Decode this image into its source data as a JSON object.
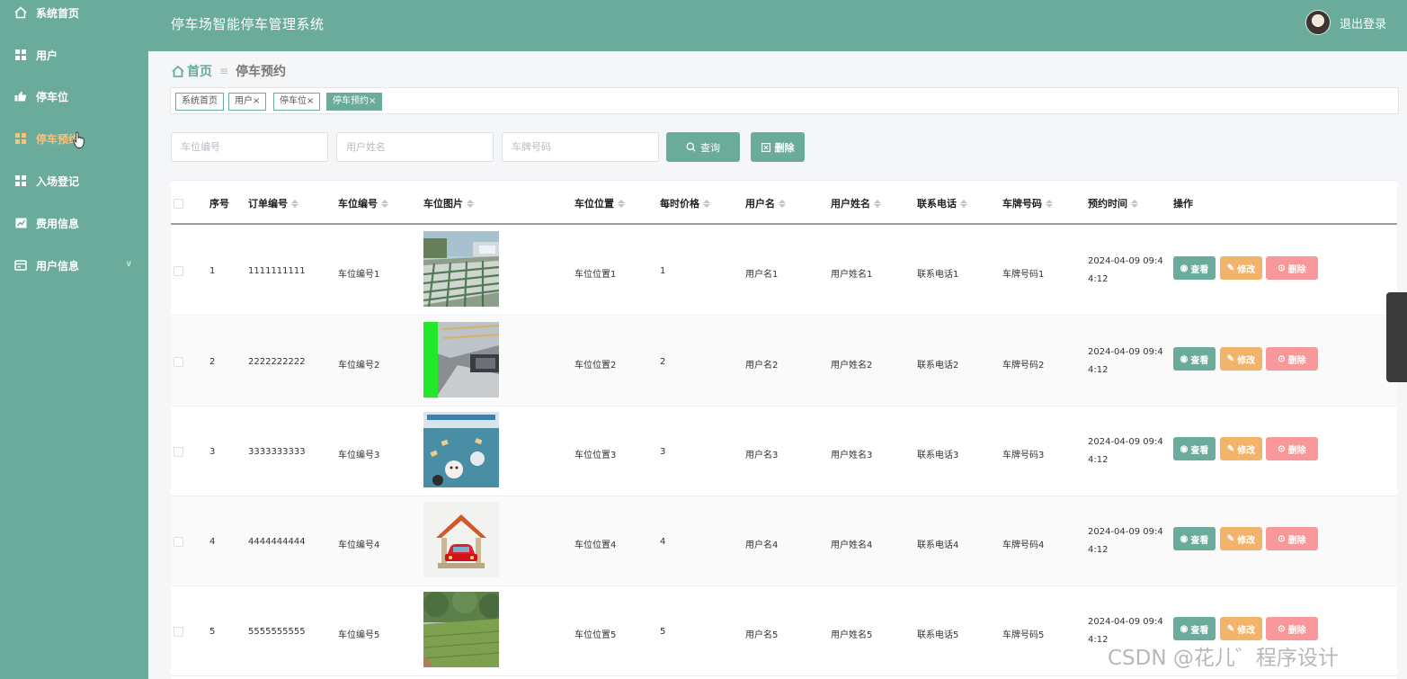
{
  "header": {
    "title": "停车场智能停车管理系统",
    "logout": "退出登录"
  },
  "sidebar": {
    "items": [
      {
        "label": "系统首页",
        "icon": "home-icon"
      },
      {
        "label": "用户",
        "icon": "grid-icon"
      },
      {
        "label": "停车位",
        "icon": "thumb-icon"
      },
      {
        "label": "停车预约",
        "icon": "grid-icon",
        "active": true
      },
      {
        "label": "入场登记",
        "icon": "grid-icon"
      },
      {
        "label": "费用信息",
        "icon": "chart-icon"
      },
      {
        "label": "用户信息",
        "icon": "card-icon"
      }
    ]
  },
  "breadcrumb": {
    "home": "首页",
    "current": "停车预约"
  },
  "tags": [
    "系统首页",
    "用户×",
    "停车位×",
    "停车预约×"
  ],
  "search": {
    "placeholders": [
      "车位编号",
      "用户姓名",
      "车牌号码"
    ],
    "query_label": "查询",
    "delete_label": "删除"
  },
  "table": {
    "headers": [
      "序号",
      "订单编号",
      "车位编号",
      "车位图片",
      "车位位置",
      "每时价格",
      "用户名",
      "用户姓名",
      "联系电话",
      "车牌号码",
      "预约时间",
      "操作"
    ],
    "rows": [
      {
        "index": "1",
        "order": "1111111111",
        "spot": "车位编号1",
        "location": "车位位置1",
        "price": "1",
        "username": "用户名1",
        "name": "用户姓名1",
        "phone": "联系电话1",
        "plate": "车牌号码1",
        "time": "2024-04-09 09:44:12"
      },
      {
        "index": "2",
        "order": "2222222222",
        "spot": "车位编号2",
        "location": "车位位置2",
        "price": "2",
        "username": "用户名2",
        "name": "用户姓名2",
        "phone": "联系电话2",
        "plate": "车牌号码2",
        "time": "2024-04-09 09:44:12"
      },
      {
        "index": "3",
        "order": "3333333333",
        "spot": "车位编号3",
        "location": "车位位置3",
        "price": "3",
        "username": "用户名3",
        "name": "用户姓名3",
        "phone": "联系电话3",
        "plate": "车牌号码3",
        "time": "2024-04-09 09:44:12"
      },
      {
        "index": "4",
        "order": "4444444444",
        "spot": "车位编号4",
        "location": "车位位置4",
        "price": "4",
        "username": "用户名4",
        "name": "用户姓名4",
        "phone": "联系电话4",
        "plate": "车牌号码4",
        "time": "2024-04-09 09:44:12"
      },
      {
        "index": "5",
        "order": "5555555555",
        "spot": "车位编号5",
        "location": "车位位置5",
        "price": "5",
        "username": "用户名5",
        "name": "用户姓名5",
        "phone": "联系电话5",
        "plate": "车牌号码5",
        "time": "2024-04-09 09:44:12"
      }
    ],
    "actions": {
      "view": "查看",
      "edit": "修改",
      "delete": "删除"
    }
  },
  "watermark": "CSDN @花儿゛程序设计",
  "colors": {
    "primary": "#6aab9c",
    "warning": "#f2b36a",
    "danger": "#f9989a",
    "active_menu": "#f6c37c"
  }
}
